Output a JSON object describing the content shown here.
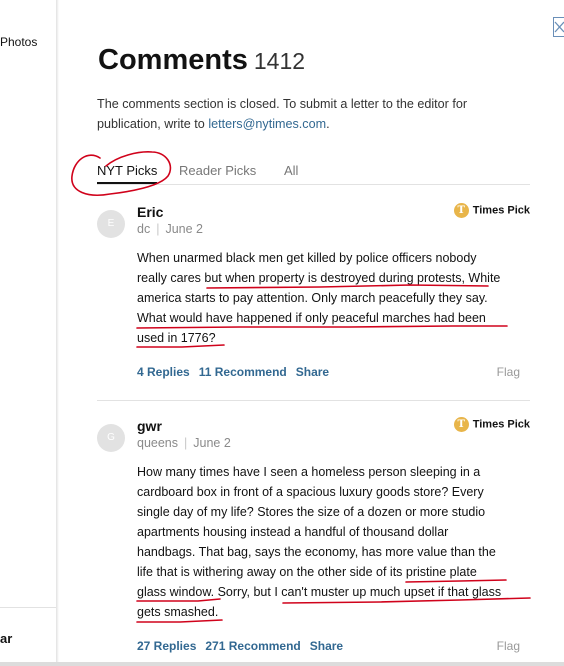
{
  "background_page": {
    "photos_label": "Photos",
    "bottom_label": "ar"
  },
  "header": {
    "title": "Comments",
    "count": "1412"
  },
  "notice": {
    "text": "The comments section is closed. To submit a letter to the editor for publication, write to ",
    "email": "letters@nytimes.com",
    "end": "."
  },
  "tabs": [
    "NYT Picks",
    "Reader Picks",
    "All"
  ],
  "comments": [
    {
      "avatar_letter": "E",
      "author": "Eric",
      "location": "dc",
      "date": "June 2",
      "badge": "Times Pick",
      "lines": [
        "When unarmed black men get killed by police officers nobody",
        "really cares but when property is destroyed during protests, White",
        "america starts to pay attention. Only march peacefully they say.",
        "What would have happened if only peaceful marches had been",
        "used in 1776?"
      ],
      "replies": "4 Replies",
      "recommend": "11 Recommend",
      "share": "Share",
      "flag": "Flag"
    },
    {
      "avatar_letter": "G",
      "author": "gwr",
      "location": "queens",
      "date": "June 2",
      "badge": "Times Pick",
      "lines": [
        "How many times have I seen a homeless person sleeping in a",
        "cardboard box in front of a spacious luxury goods store? Every",
        "single day of my life?  Stores the size of a dozen or more studio",
        "apartments housing instead a handful of thousand dollar",
        "handbags. That bag, says the economy, has more value than the",
        "life that is withering away on the other side of its pristine plate",
        "glass window. Sorry, but I can't muster up much upset if that glass",
        "gets smashed."
      ],
      "replies": "27 Replies",
      "recommend": "271 Recommend",
      "share": "Share",
      "flag": "Flag"
    }
  ],
  "colors": {
    "link": "#326891",
    "annotation": "#d0021b",
    "times_pick": "#e8b54a"
  }
}
